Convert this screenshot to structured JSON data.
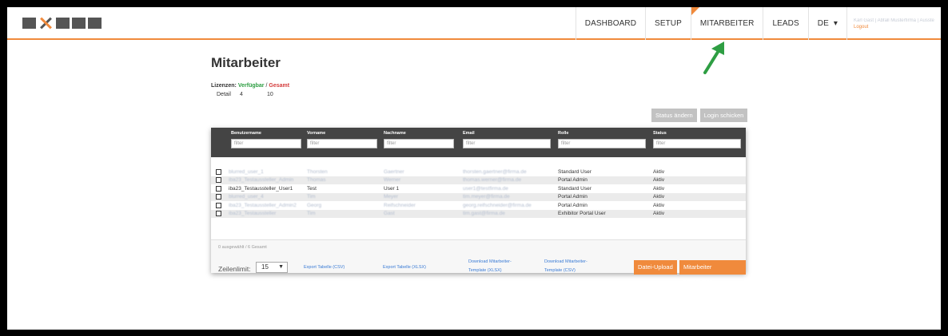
{
  "header": {
    "logo_text": "AXESS",
    "nav": [
      {
        "label": "DASHBOARD"
      },
      {
        "label": "SETUP"
      },
      {
        "label": "MITARBEITER"
      },
      {
        "label": "LEADS"
      }
    ],
    "lang": "DE",
    "lang_chevron": "▾",
    "user_name": "Karl Gast | Abfall Musterfirma | Aussteller Portal Admin",
    "logout": "Logout"
  },
  "page": {
    "title": "Mitarbeiter",
    "licenses_label": "Lizenzen:",
    "licenses_available_label": "Verfügbar",
    "licenses_separator": "/",
    "licenses_total_label": "Gesamt",
    "license_type": "Detail",
    "license_available": "4",
    "license_total": "10"
  },
  "actions": {
    "status_change": "Status ändern",
    "send_login": "Login schicken"
  },
  "table": {
    "columns": [
      {
        "label": "Benutzername",
        "placeholder": "filter"
      },
      {
        "label": "Vorname",
        "placeholder": "filter"
      },
      {
        "label": "Nachname",
        "placeholder": "filter"
      },
      {
        "label": "Email",
        "placeholder": "filter"
      },
      {
        "label": "Rolle",
        "placeholder": "filter"
      },
      {
        "label": "Status",
        "placeholder": "filter"
      }
    ],
    "rows": [
      {
        "username": "blurred_user_1",
        "first": "Thorsten",
        "last": "Gaertner",
        "email": "thorsten.gaertner@firma.de",
        "role": "Standard User",
        "status": "Aktiv"
      },
      {
        "username": "iba23_Testaussteller_Admin",
        "first": "Thomas",
        "last": "Werner",
        "email": "thomas.werner@firma.de",
        "role": "Portal Admin",
        "status": "Aktiv"
      },
      {
        "username": "iba23_Testaussteller_User1",
        "first": "Test",
        "last": "User 1",
        "email": "user1@testfirma.de",
        "role": "Standard User",
        "status": "Aktiv"
      },
      {
        "username": "blurred_user_4",
        "first": "Tim",
        "last": "Meyer",
        "email": "tim.meyer@firma.de",
        "role": "Portal Admin",
        "status": "Aktiv"
      },
      {
        "username": "iba23_Testaussteller_Admin2",
        "first": "Georg",
        "last": "Reifschneider",
        "email": "georg.reifschneider@firma.de",
        "role": "Portal Admin",
        "status": "Aktiv"
      },
      {
        "username": "iba23_Testaussteller",
        "first": "Tim",
        "last": "Gast",
        "email": "tim.gast@firma.de",
        "role": "Exhibitor Portal User",
        "status": "Aktiv"
      }
    ],
    "selection_info": "0 ausgewählt / 6 Gesamt"
  },
  "footer": {
    "rowlimit_label": "Zeilenlimit:",
    "rowlimit_value": "15",
    "rowlimit_chevron": "▼",
    "export_csv": "Export Tabelle (CSV)",
    "export_xlsx": "Export Tabelle (XLSX)",
    "download_template_xlsx_1": "Download Mitarbeiter-",
    "download_template_xlsx_2": "Template (XLSX)",
    "download_template_csv_1": "Download Mitarbeiter-",
    "download_template_csv_2": "Template (CSV)",
    "upload": "Datei-Upload",
    "add_employee": "Mitarbeiter hinzufügen"
  },
  "colors": {
    "accent": "#f08a3c",
    "header_bg": "#444444",
    "link": "#3a7bd5",
    "available": "#2e9e43",
    "total": "#d43c3c",
    "arrow": "#2e9e43"
  }
}
